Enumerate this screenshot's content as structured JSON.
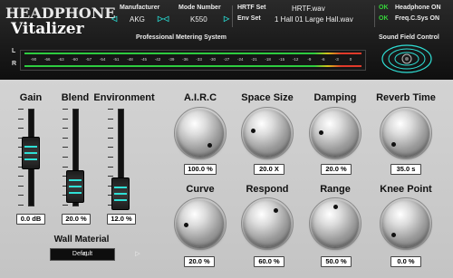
{
  "branding": {
    "line1": "HEADPHONE",
    "line2": "Vitalizer"
  },
  "header": {
    "manufacturer_label": "Manufacturer",
    "manufacturer_value": "AKG",
    "model_label": "Mode Number",
    "model_value": "K550",
    "hrtf_label": "HRTF Set",
    "hrtf_value": "HRTF.wav",
    "env_label": "Env Set",
    "env_value": "1 Hall 01 Large Hall.wav",
    "headphone_status": "OK",
    "headphone_label": "Headphone ON",
    "freq_status": "OK",
    "freq_label": "Freq.C.Sys ON"
  },
  "metering": {
    "title": "Professional Metering System",
    "left_label": "L",
    "right_label": "R",
    "scale": [
      "-90",
      "-66",
      "-63",
      "-60",
      "-57",
      "-54",
      "-51",
      "-48",
      "-45",
      "-42",
      "-39",
      "-36",
      "-33",
      "-30",
      "-27",
      "-24",
      "-21",
      "-18",
      "-15",
      "-12",
      "-9",
      "-6",
      "-3",
      "0"
    ]
  },
  "sound_field": {
    "title": "Sound Field Control"
  },
  "faders": [
    {
      "label": "Gain",
      "value": "0.0",
      "unit": "dB",
      "level": 0.55
    },
    {
      "label": "Blend",
      "value": "20.0",
      "unit": "%",
      "level": 0.2
    },
    {
      "label": "Environment",
      "value": "12.0",
      "unit": "%",
      "level": 0.12
    }
  ],
  "knobs": [
    {
      "label": "A.I.R.C",
      "value": "100.0",
      "unit": "%"
    },
    {
      "label": "Space Size",
      "value": "20.0",
      "unit": "X"
    },
    {
      "label": "Damping",
      "value": "20.0",
      "unit": "%"
    },
    {
      "label": "Reverb Time",
      "value": "35.0",
      "unit": "s"
    },
    {
      "label": "Curve",
      "value": "20.0",
      "unit": "%"
    },
    {
      "label": "Respond",
      "value": "60.0",
      "unit": "%"
    },
    {
      "label": "Range",
      "value": "50.0",
      "unit": "%"
    },
    {
      "label": "Knee Point",
      "value": "0.0",
      "unit": "%"
    }
  ],
  "wall_material": {
    "label": "Wall Material",
    "value": "Default"
  },
  "colors": {
    "accent": "#2fe0d6",
    "ok_green": "#35d63a",
    "meter_green": "#2ecc40",
    "meter_red": "#e03a2a"
  }
}
